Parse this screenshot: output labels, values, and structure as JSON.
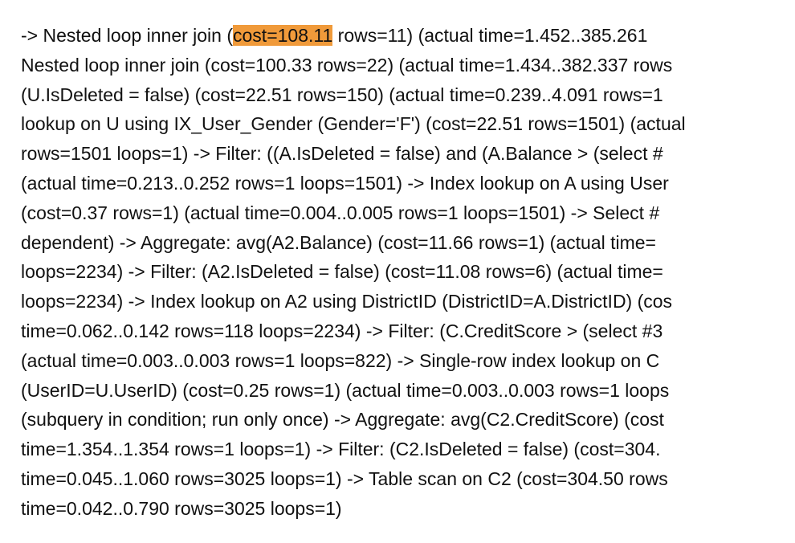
{
  "highlight_color": "#f09a3a",
  "first_line": {
    "before": "-> Nested loop inner join (",
    "highlight": "cost=108.11",
    "after": " rows=11) (actual time=1.452..385.261"
  },
  "lines": [
    "Nested loop inner join (cost=100.33 rows=22) (actual time=1.434..382.337 rows",
    "(U.IsDeleted = false) (cost=22.51 rows=150) (actual time=0.239..4.091 rows=1",
    "lookup on U using IX_User_Gender (Gender='F') (cost=22.51 rows=1501) (actual",
    "rows=1501 loops=1) -> Filter: ((A.IsDeleted = false) and (A.Balance > (select #",
    "(actual time=0.213..0.252 rows=1 loops=1501) -> Index lookup on A using User",
    "(cost=0.37 rows=1) (actual time=0.004..0.005 rows=1 loops=1501) -> Select #",
    "dependent) -> Aggregate: avg(A2.Balance) (cost=11.66 rows=1) (actual time=",
    "loops=2234) -> Filter: (A2.IsDeleted = false) (cost=11.08 rows=6) (actual time=",
    "loops=2234) -> Index lookup on A2 using DistrictID (DistrictID=A.DistrictID) (cos",
    "time=0.062..0.142 rows=118 loops=2234) -> Filter: (C.CreditScore > (select #3",
    "(actual time=0.003..0.003 rows=1 loops=822) -> Single-row index lookup on C",
    "(UserID=U.UserID) (cost=0.25 rows=1) (actual time=0.003..0.003 rows=1 loops",
    "(subquery in condition; run only once) -> Aggregate: avg(C2.CreditScore) (cost",
    "time=1.354..1.354 rows=1 loops=1) -> Filter: (C2.IsDeleted = false) (cost=304.",
    "time=0.045..1.060 rows=3025 loops=1) -> Table scan on C2 (cost=304.50 rows",
    "time=0.042..0.790 rows=3025 loops=1)"
  ]
}
